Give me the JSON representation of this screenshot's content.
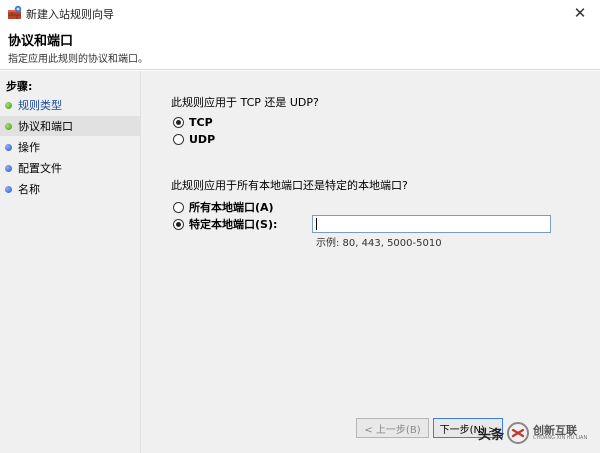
{
  "window": {
    "title": "新建入站规则向导",
    "close_glyph": "✕"
  },
  "header": {
    "title": "协议和端口",
    "description": "指定应用此规则的协议和端口。"
  },
  "sidebar": {
    "heading": "步骤:",
    "items": [
      {
        "label": "规则类型",
        "status": "done",
        "dot": "green"
      },
      {
        "label": "协议和端口",
        "status": "current",
        "dot": "green"
      },
      {
        "label": "操作",
        "status": "pending",
        "dot": "blue"
      },
      {
        "label": "配置文件",
        "status": "pending",
        "dot": "blue"
      },
      {
        "label": "名称",
        "status": "pending",
        "dot": "blue"
      }
    ]
  },
  "protocol": {
    "question": "此规则应用于 TCP 还是 UDP?",
    "options": [
      {
        "label": "TCP",
        "checked": true
      },
      {
        "label": "UDP",
        "checked": false
      }
    ]
  },
  "ports": {
    "question": "此规则应用于所有本地端口还是特定的本地端口?",
    "options": [
      {
        "label": "所有本地端口(A)",
        "checked": false
      },
      {
        "label": "特定本地端口(S):",
        "checked": true
      }
    ],
    "input_value": "",
    "example": "示例: 80, 443, 5000-5010"
  },
  "buttons": {
    "back": "< 上一步(B)",
    "next": "下一步(N) >"
  },
  "watermark": {
    "text": "头条",
    "brand_cn": "创新互联",
    "brand_en": "CHUANG XIN HU LIAN"
  },
  "colors": {
    "content_bg": "#f0f0f0",
    "active_step_bg": "#e1e1e1",
    "link_blue": "#1a4aa0",
    "focus_border": "#3c7fd4"
  }
}
